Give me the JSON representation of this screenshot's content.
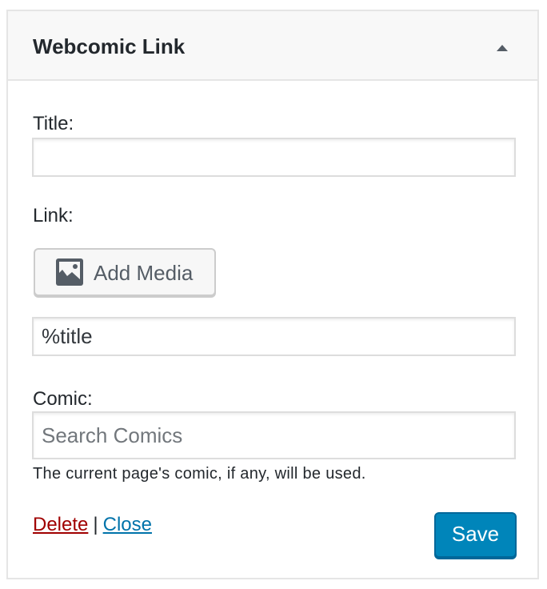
{
  "widget": {
    "title": "Webcomic Link",
    "toggle_icon": "arrow-up-icon"
  },
  "form": {
    "title_label": "Title:",
    "title_value": "",
    "link_label": "Link:",
    "add_media_label": "Add Media",
    "add_media_icon": "media-image-icon",
    "link_text_value": "%title",
    "comic_label": "Comic:",
    "comic_placeholder": "Search Comics",
    "comic_hint": "The current page's comic, if any, will be used."
  },
  "actions": {
    "delete_label": "Delete",
    "separator": "|",
    "close_label": "Close",
    "save_label": "Save"
  },
  "colors": {
    "delete_link": "#a00000",
    "close_link": "#0073aa",
    "save_button": "#0085ba"
  }
}
